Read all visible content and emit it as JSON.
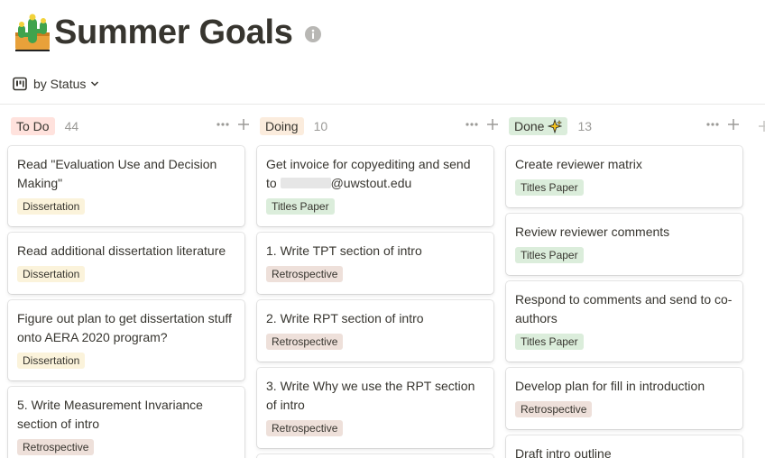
{
  "page": {
    "title": "Summer Goals",
    "icon": "cactus-emoji-icon",
    "info_icon": "info-icon"
  },
  "view": {
    "label": "by Status",
    "icon": "board-icon",
    "chevron": "chevron-down-icon"
  },
  "colors": {
    "todo_bg": "#ffe2dd",
    "doing_bg": "#fbecdd",
    "done_bg": "#dbeddb",
    "dissertation_bg": "#fbf3db",
    "titles_paper_bg": "#dbeddb",
    "retrospective_bg": "#eee0da",
    "text": "#37352f",
    "muted": "#9b9a97"
  },
  "columns": [
    {
      "status": "To Do",
      "count": "44",
      "cards": [
        {
          "title": "Read \"Evaluation Use and Decision Making\"",
          "tag": "Dissertation"
        },
        {
          "title": "Read additional dissertation literature",
          "tag": "Dissertation"
        },
        {
          "title": "Figure out plan to get dissertation stuff onto AERA 2020 program?",
          "tag": "Dissertation"
        },
        {
          "title": "5. Write Measurement Invariance section of intro",
          "tag": "Retrospective"
        }
      ]
    },
    {
      "status": "Doing",
      "count": "10",
      "cards": [
        {
          "title_before": "Get invoice for copyediting and send to",
          "title_after": "@uwstout.edu",
          "tag": "Titles Paper"
        },
        {
          "title": "1. Write TPT section of intro",
          "tag": "Retrospective"
        },
        {
          "title": "2. Write RPT section of intro",
          "tag": "Retrospective"
        },
        {
          "title": "3. Write Why we use the RPT section of intro",
          "tag": "Retrospective"
        }
      ]
    },
    {
      "status": "Done",
      "count": "13",
      "status_icon": "sparkle-icon",
      "cards": [
        {
          "title": "Create reviewer matrix",
          "tag": "Titles Paper"
        },
        {
          "title": "Review reviewer comments",
          "tag": "Titles Paper"
        },
        {
          "title": "Respond to comments and send to co-authors",
          "tag": "Titles Paper"
        },
        {
          "title": "Develop plan for fill in introduction",
          "tag": "Retrospective"
        },
        {
          "title": "Draft intro outline"
        }
      ]
    }
  ]
}
